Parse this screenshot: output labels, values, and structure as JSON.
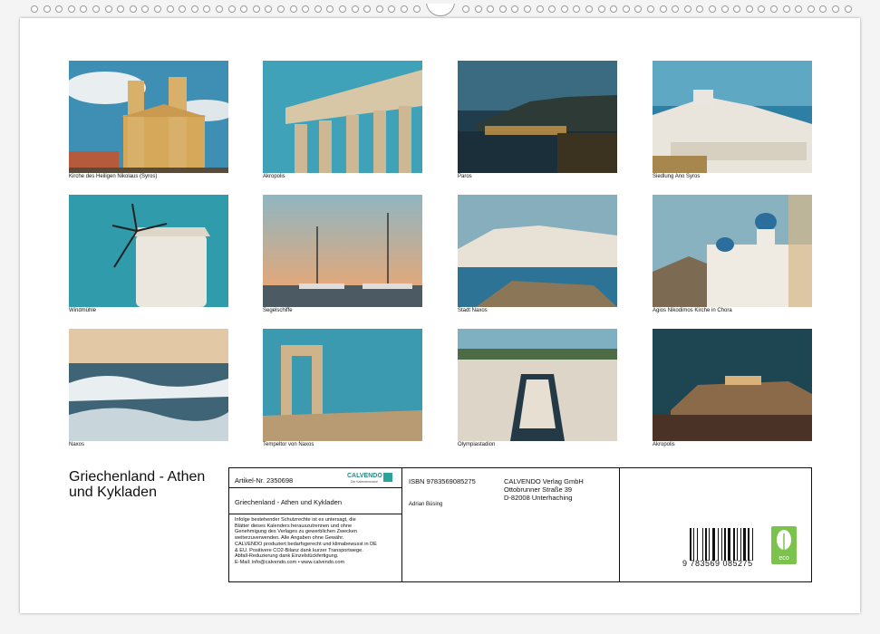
{
  "photos": [
    {
      "caption": "Kirche des Heiligen Nikolaus (Syros)",
      "icon": "church-photo"
    },
    {
      "caption": "Akropolis",
      "icon": "parthenon-photo"
    },
    {
      "caption": "Paros",
      "icon": "night-harbor-photo"
    },
    {
      "caption": "Siedlung Ano Syros",
      "icon": "hill-village-photo"
    },
    {
      "caption": "Windmühle",
      "icon": "windmill-photo"
    },
    {
      "caption": "Segelschiffe",
      "icon": "sailboats-photo"
    },
    {
      "caption": "Stadt Naxos",
      "icon": "coastal-town-photo"
    },
    {
      "caption": "Agios Nikodimos Kirche in Chora",
      "icon": "white-church-photo"
    },
    {
      "caption": "Naxos",
      "icon": "waves-photo"
    },
    {
      "caption": "Tempeltor von Naxos",
      "icon": "portara-photo"
    },
    {
      "caption": "Olympiastadion",
      "icon": "stadium-photo"
    },
    {
      "caption": "Akropolis",
      "icon": "acropolis-night-photo"
    }
  ],
  "title": "Griechenland - Athen und Kykladen",
  "info": {
    "article": "Artikel-Nr. 2350698",
    "brand": "CALVENDO",
    "brand_sub": "Die Kalendermarke",
    "product_title": "Griechenland - Athen und Kykladen",
    "isbn": "ISBN 9783569085275",
    "publisher": [
      "CALVENDO Verlag GmbH",
      "Ottobrunner Straße 39",
      "D-82008 Unterhaching"
    ],
    "author": "Adrian Büsing",
    "legal": [
      "Infolge bestehender Schutzrechte ist es untersagt, die",
      "Blätter dieses Kalenders herauszutrennen und ohne",
      "Genehmigung des Verlages zu gewerblichen Zwecken",
      "weiterzuverwenden. Alle Angaben ohne Gewähr.",
      "CALVENDO produziert bedarfsgerecht und klimabewusst in DE",
      "& EU. Positivere CO2-Bilanz dank kurzer Transportwege.",
      "Abfall-Reduzierung dank Einzelstückfertigung.",
      "E-Mail: info@calvendo.com • www.calvendo.com"
    ],
    "barcode_digits": "9  783569  085275",
    "eco_label": "eco"
  },
  "colors": {
    "accent": "#2ba39b",
    "eco": "#7cc34e"
  }
}
